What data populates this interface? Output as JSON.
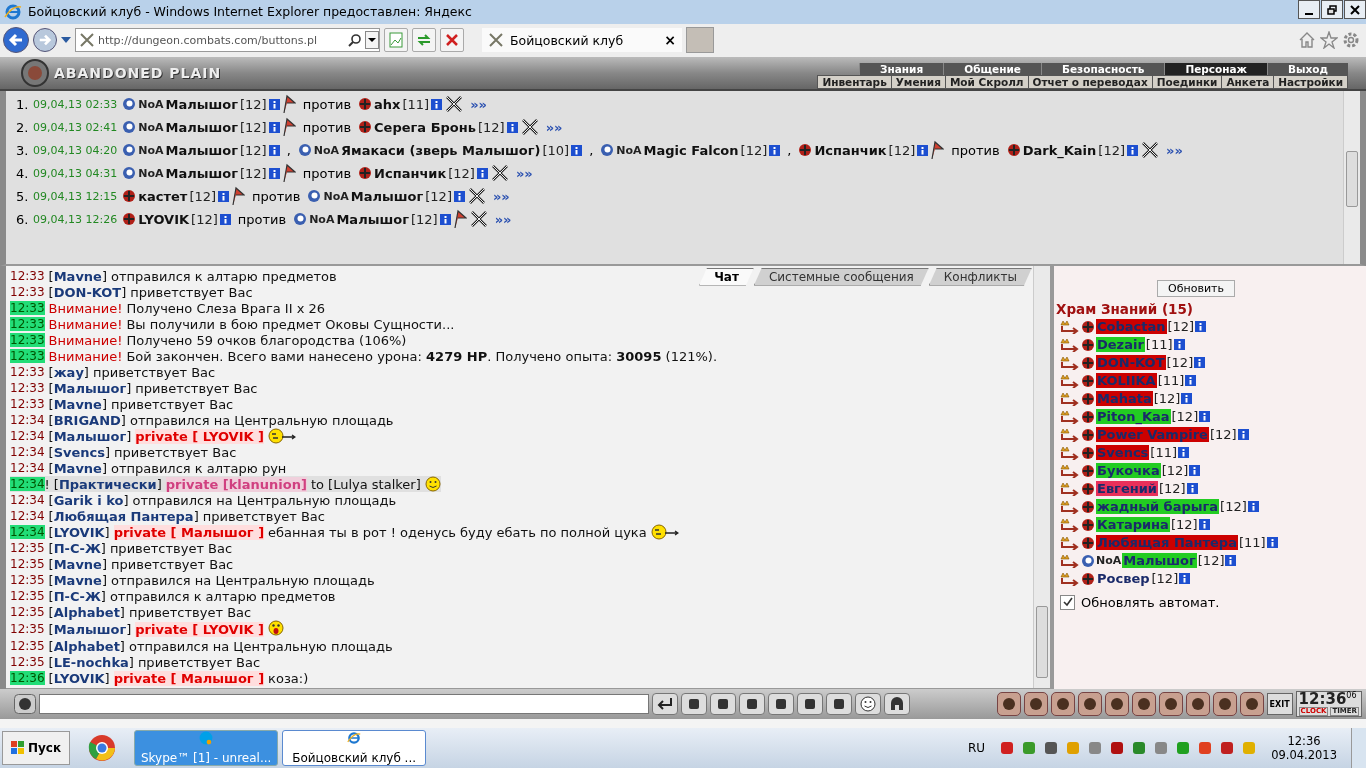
{
  "window": {
    "title": "Бойцовский клуб - Windows Internet Explorer предоставлен: Яндекс"
  },
  "browser": {
    "url": "http://dungeon.combats.com/buttons.pl",
    "tab": {
      "title": "Бойцовский клуб",
      "close": "×"
    }
  },
  "game": {
    "logo": "ABANDONED PLAIN",
    "menu": [
      {
        "label": "Знания",
        "selected": false
      },
      {
        "label": "Общение",
        "selected": false
      },
      {
        "label": "Безопасность",
        "selected": false
      },
      {
        "label": "Персонаж",
        "selected": true
      },
      {
        "label": "Выход",
        "selected": false
      }
    ],
    "submenu": [
      "Инвентарь",
      "Умения",
      "Мой Скролл",
      "Отчет о переводах",
      "Поединки",
      "Анкета",
      "Настройки"
    ]
  },
  "battles": [
    {
      "num": "1.",
      "date": "09,04,13 02:33",
      "parts": [
        {
          "kind": "player",
          "prefix": "NoA",
          "name": "Малышог",
          "level": "[12]",
          "flag": true
        },
        {
          "kind": "text",
          "text": "против"
        },
        {
          "kind": "player",
          "name": "ahx",
          "level": "[11]",
          "flag": false
        }
      ],
      "link": "»»"
    },
    {
      "num": "2.",
      "date": "09,04,13 02:41",
      "parts": [
        {
          "kind": "player",
          "prefix": "NoA",
          "name": "Малышог",
          "level": "[12]",
          "flag": true
        },
        {
          "kind": "text",
          "text": "против"
        },
        {
          "kind": "player",
          "name": "Серега Бронь",
          "level": "[12]",
          "flag": false
        }
      ],
      "link": "»»"
    },
    {
      "num": "3.",
      "date": "09,04,13 04:20",
      "parts": [
        {
          "kind": "player",
          "prefix": "NoA",
          "name": "Малышог",
          "level": "[12]",
          "flag": false
        },
        {
          "kind": "text",
          "text": ","
        },
        {
          "kind": "player",
          "prefix": "NoA",
          "name": "Ямакаси (зверь Малышог)",
          "level": "[10]",
          "flag": false
        },
        {
          "kind": "text",
          "text": ","
        },
        {
          "kind": "player",
          "prefix": "NoA",
          "name": "Magic Falcon",
          "level": "[12]",
          "flag": false
        },
        {
          "kind": "text",
          "text": ","
        },
        {
          "kind": "player",
          "name": "Испанчик",
          "level": "[12]",
          "flag": true
        },
        {
          "kind": "text",
          "text": "против"
        },
        {
          "kind": "player",
          "name": "Dark_Kain",
          "level": "[12]",
          "flag": false
        }
      ],
      "link": "»»"
    },
    {
      "num": "4.",
      "date": "09,04,13 04:31",
      "parts": [
        {
          "kind": "player",
          "prefix": "NoA",
          "name": "Малышог",
          "level": "[12]",
          "flag": true
        },
        {
          "kind": "text",
          "text": "против"
        },
        {
          "kind": "player",
          "name": "Испанчик",
          "level": "[12]",
          "flag": false
        }
      ],
      "link": "»»"
    },
    {
      "num": "5.",
      "date": "09,04,13 12:15",
      "parts": [
        {
          "kind": "player",
          "name": "кастет",
          "level": "[12]",
          "flag": true
        },
        {
          "kind": "text",
          "text": "против"
        },
        {
          "kind": "player",
          "prefix": "NoA",
          "name": "Малышог",
          "level": "[12]",
          "flag": false
        }
      ],
      "link": "»»"
    },
    {
      "num": "6.",
      "date": "09,04,13 12:26",
      "parts": [
        {
          "kind": "player",
          "name": "LYOVIK",
          "level": "[12]",
          "flag": false
        },
        {
          "kind": "text",
          "text": "против"
        },
        {
          "kind": "player",
          "prefix": "NoA",
          "name": "Малышог",
          "level": "[12]",
          "flag": true
        }
      ],
      "link": "»»"
    }
  ],
  "chat_tabs": [
    {
      "label": "Чат",
      "selected": true
    },
    {
      "label": "Системные сообщения",
      "selected": false
    },
    {
      "label": "Конфликты",
      "selected": false
    }
  ],
  "chat": [
    {
      "time": "12:33",
      "highlighted": false,
      "kind": "event",
      "nick": "[**Mavne**]",
      "text": "отправился к алтарю предметов"
    },
    {
      "time": "12:33",
      "highlighted": false,
      "kind": "event",
      "nick": "[**DON-KOT**]",
      "text": "приветствует Вас"
    },
    {
      "time": "12:33",
      "highlighted": true,
      "kind": "system",
      "alert": "Внимание!",
      "text": "Получено Слеза Врага II x 26"
    },
    {
      "time": "12:33",
      "highlighted": true,
      "kind": "system",
      "alert": "Внимание!",
      "text": "Вы получили в бою предмет Оковы Сущности..."
    },
    {
      "time": "12:33",
      "highlighted": true,
      "kind": "system",
      "alert": "Внимание!",
      "text": "Получено 59 очков благородства (106%)"
    },
    {
      "time": "12:33",
      "highlighted": true,
      "kind": "system",
      "alert": "Внимание!",
      "text": "Бой закончен. Всего вами нанесено урона: **4279 HP**. Получено опыта: **30095** (121%)."
    },
    {
      "time": "12:33",
      "highlighted": false,
      "kind": "event",
      "nick": "[**жау**]",
      "text": "приветствует Вас"
    },
    {
      "time": "12:33",
      "highlighted": false,
      "kind": "event",
      "nick": "[**Малышог**]",
      "text": "приветствует Вас"
    },
    {
      "time": "12:33",
      "highlighted": false,
      "kind": "event",
      "nick": "[**Mavne**]",
      "text": "приветствует Вас"
    },
    {
      "time": "12:34",
      "highlighted": false,
      "kind": "event",
      "nick": "[**BRIGAND**]",
      "text": "отправился на Центральную площадь"
    },
    {
      "time": "12:34",
      "highlighted": false,
      "kind": "private",
      "nick": "[**Малышог**]",
      "private": "private [ LYOVIK ]",
      "smiley": {
        "kind": "wink"
      }
    },
    {
      "time": "12:34",
      "highlighted": false,
      "kind": "event",
      "nick": "[**Svencs**]",
      "text": "приветствует Вас"
    },
    {
      "time": "12:34",
      "highlighted": false,
      "kind": "event",
      "nick": "[**Mavne**]",
      "text": "отправился к алтарю рун"
    },
    {
      "time": "12:34",
      "highlighted": true,
      "kind": "clan",
      "mark": "!",
      "nick": "[**Практически**]",
      "private": "private [klanunion]",
      "text": "to [Lulya stalker]",
      "smiley": {
        "kind": "smile"
      }
    },
    {
      "time": "12:34",
      "highlighted": false,
      "kind": "event",
      "nick": "[**Garik i ko**]",
      "text": "отправился на Центральную площадь"
    },
    {
      "time": "12:34",
      "highlighted": false,
      "kind": "event",
      "nick": "[**Любящая Пантера**]",
      "text": "приветствует Вас"
    },
    {
      "time": "12:34",
      "highlighted": true,
      "kind": "private",
      "nick": "[**LYOVIK**]",
      "private": "private [ Малышог ]",
      "text": "ебанная ты в рот ! оденусь буду ебать по полной цука",
      "smiley": {
        "kind": "wink"
      }
    },
    {
      "time": "12:35",
      "highlighted": false,
      "kind": "event",
      "nick": "[**П-С-Ж**]",
      "text": "приветствует Вас"
    },
    {
      "time": "12:35",
      "highlighted": false,
      "kind": "event",
      "nick": "[**Mavne**]",
      "text": "приветствует Вас"
    },
    {
      "time": "12:35",
      "highlighted": false,
      "kind": "event",
      "nick": "[**Mavne**]",
      "text": "отправился на Центральную площадь"
    },
    {
      "time": "12:35",
      "highlighted": false,
      "kind": "event",
      "nick": "[**П-С-Ж**]",
      "text": "отправился к алтарю предметов"
    },
    {
      "time": "12:35",
      "highlighted": false,
      "kind": "event",
      "nick": "[**Alphabet**]",
      "text": "приветствует Вас"
    },
    {
      "time": "12:35",
      "highlighted": false,
      "kind": "private",
      "nick": "[**Малышог**]",
      "private": "private [ LYOVIK ]",
      "smiley": {
        "kind": "shocked"
      }
    },
    {
      "time": "12:35",
      "highlighted": false,
      "kind": "event",
      "nick": "[**Alphabet**]",
      "text": "отправился на Центральную площадь"
    },
    {
      "time": "12:35",
      "highlighted": false,
      "kind": "event",
      "nick": "[**LE-nochka**]",
      "text": "приветствует Вас"
    },
    {
      "time": "12:36",
      "highlighted": true,
      "kind": "private",
      "nick": "[**LYOVIK**]",
      "private": "private [ Малышог ]",
      "text": "коза:)"
    }
  ],
  "clan_panel": {
    "refresh": "Обновить",
    "title": "Храм Знаний (15)",
    "members": [
      {
        "name": "Cobactan",
        "level": "[12]",
        "color": "#cc0000"
      },
      {
        "name": "Dezair",
        "level": "[11]",
        "color": "#22cc22"
      },
      {
        "name": "DON-KOT",
        "level": "[12]",
        "color": "#cc0000"
      },
      {
        "name": "KOLIIKA",
        "level": "[11]",
        "color": "#cc0000"
      },
      {
        "name": "Mahata",
        "level": "[12]",
        "color": "#cc0000"
      },
      {
        "name": "Piton_Kaa",
        "level": "[12]",
        "color": "#22cc22"
      },
      {
        "name": "Power Vampire",
        "level": "[12]",
        "color": "#cc0000"
      },
      {
        "name": "Svencs",
        "level": "[11]",
        "color": "#cc0000"
      },
      {
        "name": "Букочка",
        "level": "[12]",
        "color": "#22cc22"
      },
      {
        "name": "Евгений",
        "level": "[12]",
        "color": "#e8305a"
      },
      {
        "name": "жадный барыга",
        "level": "[12]",
        "color": "#22cc22"
      },
      {
        "name": "Катарина",
        "level": "[12]",
        "color": "#22cc22"
      },
      {
        "name": "Любящая Пантера",
        "level": "[11]",
        "color": "#cc0000"
      },
      {
        "name": "Малышог",
        "prefix": "NoA",
        "level": "[12]",
        "color": "#22cc22"
      },
      {
        "name": "Росвер",
        "level": "[12]"
      }
    ],
    "auto_update": {
      "label": "Обновлять автомат.",
      "checked": true
    }
  },
  "chat_bar": {
    "exit": "EXIT",
    "clock": "12:36",
    "seconds": "06",
    "clock_label": "CLOCK",
    "timer_label": "TIMER"
  },
  "taskbar": {
    "start": "Пуск",
    "buttons": [
      {
        "kind": "chrome",
        "selected": false
      },
      {
        "kind": "skype",
        "label": "Skype™ [1] - unreal...",
        "selected": false
      },
      {
        "kind": "ie",
        "label": "Бойцовский клуб ...",
        "selected": true
      }
    ],
    "language": "RU",
    "time": "12:36",
    "date": "09.04.2013"
  }
}
